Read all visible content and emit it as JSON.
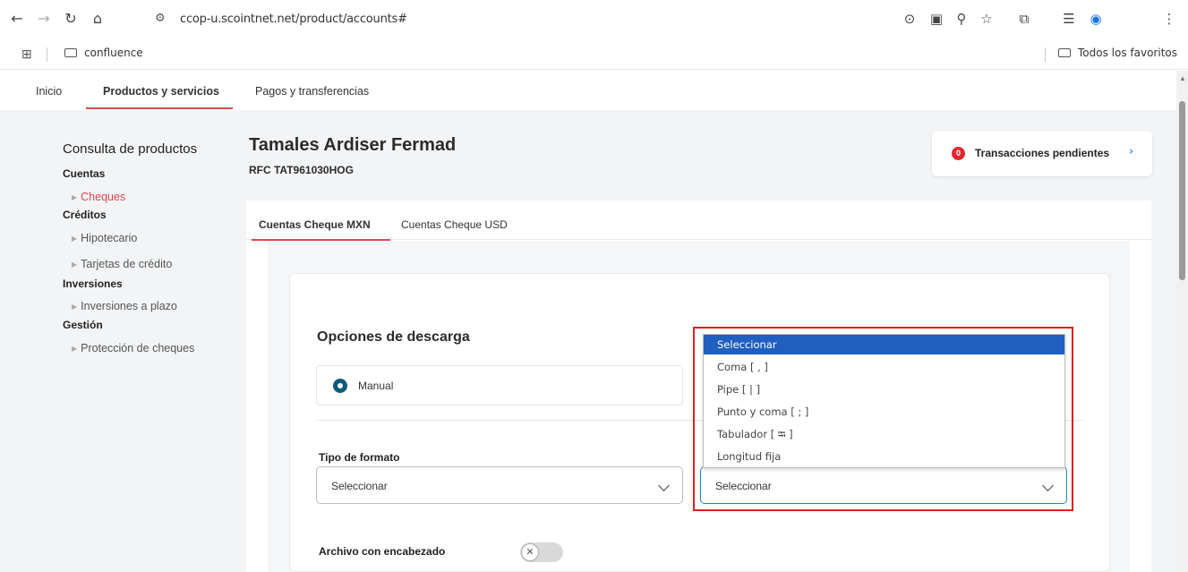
{
  "browser": {
    "url": "ccop-u.scointnet.net/product/accounts#",
    "bookmark_folder": "confluence",
    "all_bookmarks": "Todos los favoritos"
  },
  "top_nav": {
    "items": [
      "Inicio",
      "Productos y servicios",
      "Pagos y transferencias"
    ],
    "active": "Productos y servicios"
  },
  "sidebar": {
    "title": "Consulta de productos",
    "groups": [
      {
        "label": "Cuentas",
        "items": [
          "Cheques"
        ]
      },
      {
        "label": "Créditos",
        "items": [
          "Hipotecario",
          "Tarjetas de crédito"
        ]
      },
      {
        "label": "Inversiones",
        "items": [
          "Inversiones a plazo"
        ]
      },
      {
        "label": "Gestión",
        "items": [
          "Protección de cheques"
        ]
      }
    ],
    "active_item": "Cheques"
  },
  "customer": {
    "name": "Tamales Ardiser Fermad",
    "rfc": "RFC TAT961030HOG"
  },
  "pending": {
    "count": "0",
    "label": "Transacciones pendientes",
    "chevron": "›"
  },
  "tabs": {
    "items": [
      "Cuentas Cheque MXN",
      "Cuentas Cheque USD"
    ],
    "active": "Cuentas Cheque MXN"
  },
  "download": {
    "title": "Opciones de descarga",
    "mode_label": "Manual",
    "format_label": "Tipo de formato",
    "format_value": "Seleccionar",
    "separator_value": "Seleccionar",
    "separator_options": [
      "Seleccionar",
      "Coma [ , ]",
      "Pipe [ | ]",
      "Punto y coma [ ; ]",
      "Tabulador [ ⭾ ]",
      "Longitud fija"
    ],
    "separator_selected": "Seleccionar",
    "header_label": "Archivo con encabezado",
    "header_enabled": false
  },
  "colors": {
    "accent_red": "#e0464e",
    "badge_red": "#e0262f",
    "radio_teal": "#0c5b7b",
    "focus_blue": "#2d7fc1",
    "option_selected": "#1f5fbf",
    "annotation_frame": "#e01e1e"
  },
  "icons": {
    "back": "back-arrow-icon",
    "forward": "forward-arrow-icon",
    "reload": "reload-icon",
    "home": "home-icon",
    "site_info": "site-info-icon",
    "location": "location-icon",
    "translate": "translate-icon",
    "zoom": "zoom-icon",
    "star": "bookmark-star-icon",
    "extensions": "extensions-icon",
    "reading_list": "reading-list-icon",
    "profile": "profile-icon",
    "menu": "kebab-menu-icon",
    "apps": "apps-grid-icon",
    "folder": "folder-icon"
  }
}
